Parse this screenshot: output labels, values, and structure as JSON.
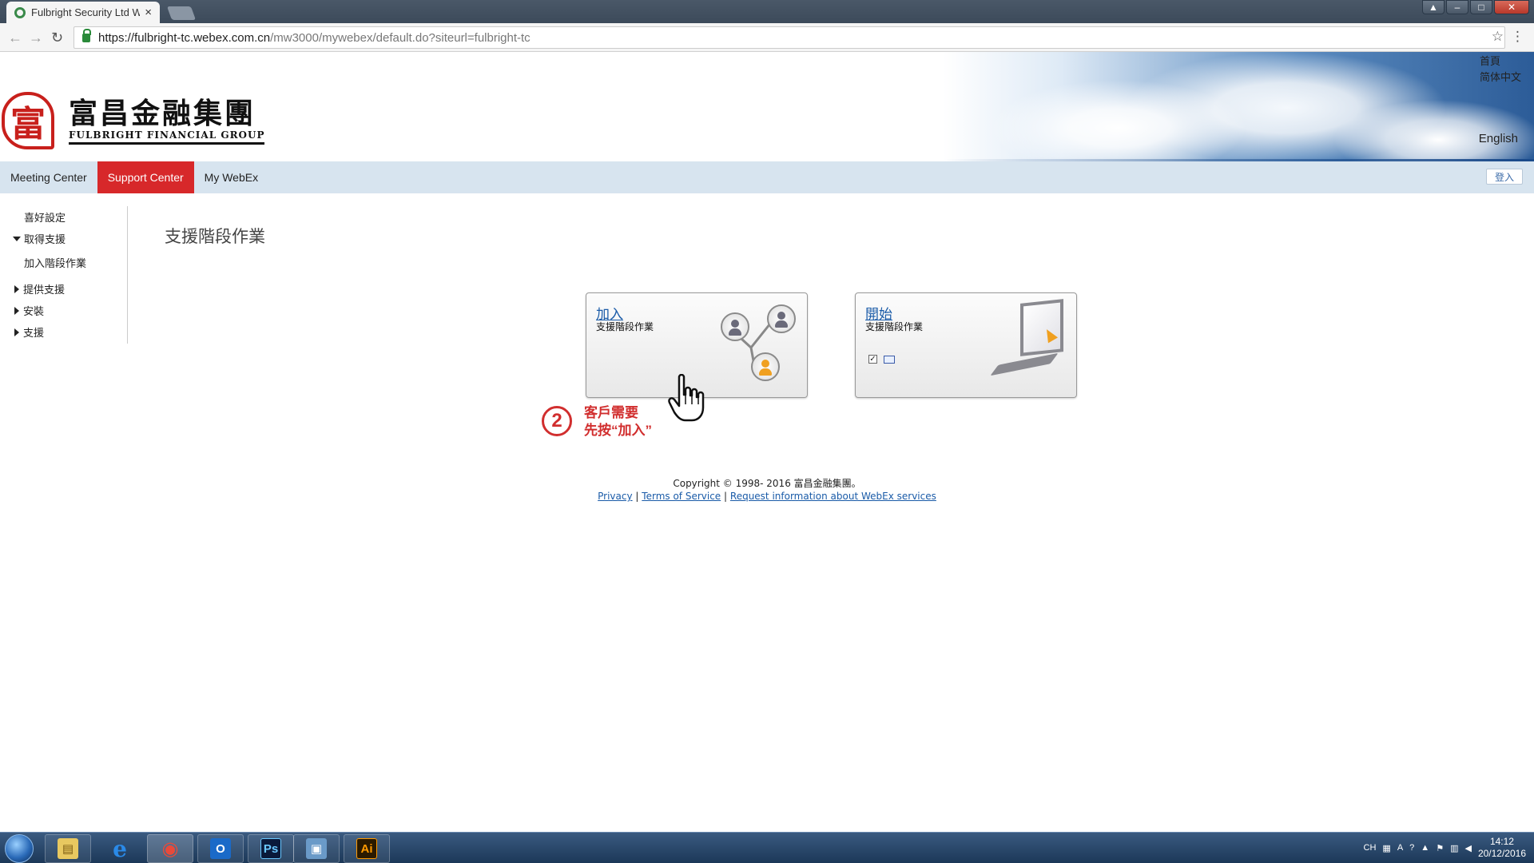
{
  "browser": {
    "tab_title": "Fulbright Security Ltd W",
    "tab_close": "×",
    "url_main": "https://fulbright-tc.webex.com.cn",
    "url_rest": "/mw3000/mywebex/default.do?siteurl=fulbright-tc",
    "back": "←",
    "forward": "→",
    "reload": "↻",
    "star": "☆",
    "menu": "⋮",
    "win_min": "–",
    "win_max": "□",
    "win_close": "✕",
    "win_user": "▲"
  },
  "header": {
    "logo_seal": "富",
    "logo_cn": "富昌金融集團",
    "logo_en": "FULBRIGHT FINANCIAL GROUP",
    "home": "首頁",
    "lang_simplified": "简体中文",
    "lang_english": "English"
  },
  "nav": {
    "meeting_center": "Meeting Center",
    "support_center": "Support Center",
    "my_webex": "My WebEx",
    "login": "登入"
  },
  "sidebar": {
    "items": [
      {
        "label": "喜好設定"
      },
      {
        "label": "取得支援"
      },
      {
        "label": "加入階段作業"
      },
      {
        "label": "提供支援"
      },
      {
        "label": "安裝"
      },
      {
        "label": "支援"
      }
    ]
  },
  "main": {
    "page_title": "支援階段作業",
    "join_card": {
      "title": "加入",
      "subtitle": "支援階段作業"
    },
    "start_card": {
      "title": "開始",
      "subtitle": "支援階段作業",
      "check": "✓"
    },
    "annotation": {
      "step": "2",
      "line1": "客戶需要",
      "line2": "先按“加入”"
    }
  },
  "footer": {
    "copyright": "Copyright © 1998- 2016 富昌金融集團。",
    "privacy": "Privacy",
    "sep": "|",
    "terms": "Terms of Service",
    "request": "Request information about WebEx services"
  },
  "taskbar": {
    "apps": [
      {
        "name": "file-explorer",
        "glyph": "▤"
      },
      {
        "name": "internet-explorer",
        "glyph": "e"
      },
      {
        "name": "chrome",
        "glyph": "◉"
      },
      {
        "name": "outlook",
        "glyph": "O"
      },
      {
        "name": "photoshop",
        "glyph": "Ps"
      },
      {
        "name": "remote-desktop",
        "glyph": "▣"
      },
      {
        "name": "illustrator",
        "glyph": "Ai"
      }
    ],
    "tray_lang": "CH",
    "time": "14:12",
    "date": "20/12/2016"
  },
  "colors": {
    "brand_red": "#d7282a",
    "nav_bg": "#d7e4ef",
    "link_blue": "#1a5ba8",
    "annotation_red": "#d12e2e"
  }
}
